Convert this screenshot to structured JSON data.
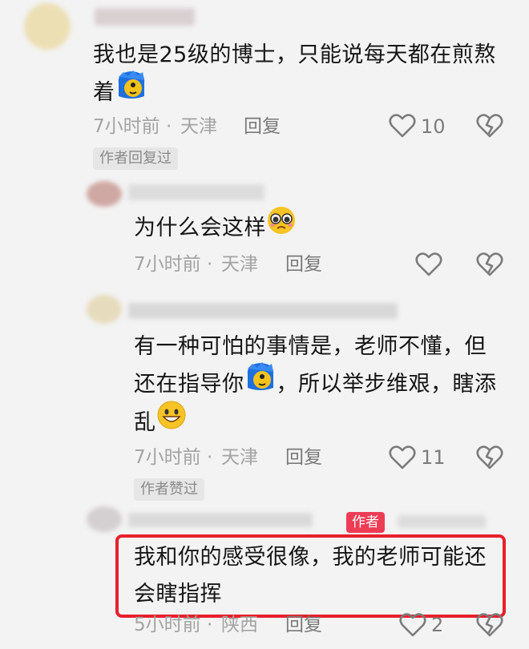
{
  "comments": [
    {
      "text": [
        "我也是25级的博士，只能说每天都在煎熬",
        "着"
      ],
      "time": "7小时前",
      "location": "天津",
      "reply_label": "回复",
      "like_count": "10",
      "tag": "作者回复过"
    },
    {
      "text": [
        "为什么会这样"
      ],
      "time": "7小时前",
      "location": "天津",
      "reply_label": "回复",
      "like_count": ""
    },
    {
      "text": [
        "有一种可怕的事情是，老师不懂，但",
        "还在指导你",
        "，所以举步维艰，瞎添",
        "乱"
      ],
      "time": "7小时前",
      "location": "天津",
      "reply_label": "回复",
      "like_count": "11",
      "tag": "作者赞过"
    },
    {
      "author_badge": "作者",
      "text": [
        "我和你的感受很像，我的老师可能还",
        "会瞎指挥"
      ],
      "time": "5小时前",
      "location": "陕西",
      "reply_label": "回复",
      "like_count": "2"
    }
  ],
  "separator": "·",
  "colors": {
    "accent": "#ee3c55",
    "highlight": "#e8202c"
  },
  "icons": [
    "heart-outline-icon",
    "broken-heart-icon",
    "blue-face-emoji-icon",
    "pleading-face-emoji-icon",
    "smiley-face-emoji-icon"
  ]
}
